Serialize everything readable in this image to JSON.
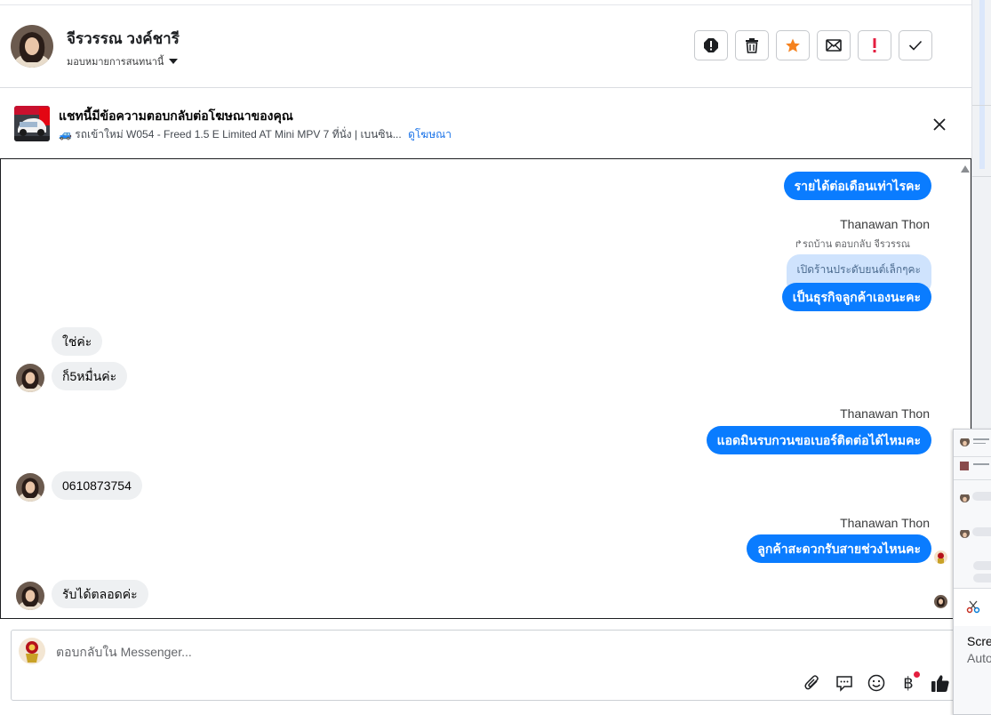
{
  "header": {
    "contact_name": "จีรวรรณ วงค์ชารี",
    "assign_label": "มอบหมายการสนทนานี้"
  },
  "ad_banner": {
    "title": "แชทนี้มีข้อความตอบกลับต่อโฆษณาของคุณ",
    "subtitle": "🚙 รถเข้าใหม่ W054 - Freed 1.5 E Limited AT Mini MPV 7 ที่นั่ง | เบนซิน...",
    "link": "ดูโฆษณา"
  },
  "messages": [
    {
      "side": "out",
      "text": "รายได้ต่อเดือนเท่าไรคะ"
    },
    {
      "side": "out",
      "sender": "Thanawan Thon",
      "reply_note": "รถบ้าน ตอบกลับ จีรวรรณ",
      "quoted": "เปิดร้านประดับยนต์เล็กๆคะ",
      "text": "เป็นธุรกิจลูกค้าเองนะคะ"
    },
    {
      "side": "in",
      "text": "ใช่ค่ะ"
    },
    {
      "side": "in",
      "text": "ก็5หมื่นค่ะ"
    },
    {
      "side": "out",
      "sender": "Thanawan Thon",
      "text": "แอดมินรบกวนขอเบอร์ติดต่อได้ไหมคะ"
    },
    {
      "side": "in",
      "text": "0610873754"
    },
    {
      "side": "out",
      "sender": "Thanawan Thon",
      "text": "ลูกค้าสะดวกรับสายช่วงไหนคะ"
    },
    {
      "side": "in",
      "text": "รับได้ตลอดค่ะ"
    }
  ],
  "composer": {
    "placeholder": "ตอบกลับใน Messenger...",
    "currency_icon": "฿"
  },
  "floating_panel": {
    "line1": "Scre",
    "line2": "Auto"
  },
  "colors": {
    "outgoing_bubble": "#0a7cff",
    "incoming_bubble": "#eef0f2",
    "star": "#f5821f",
    "alert_red": "#e41e3f",
    "link": "#1a73e8"
  },
  "icons": [
    "spam-icon",
    "trash-icon",
    "star-icon",
    "mail-icon",
    "important-icon",
    "check-icon",
    "close-icon",
    "attach-icon",
    "saved-reply-icon",
    "emoji-icon",
    "baht-icon",
    "thumbs-up-icon"
  ]
}
